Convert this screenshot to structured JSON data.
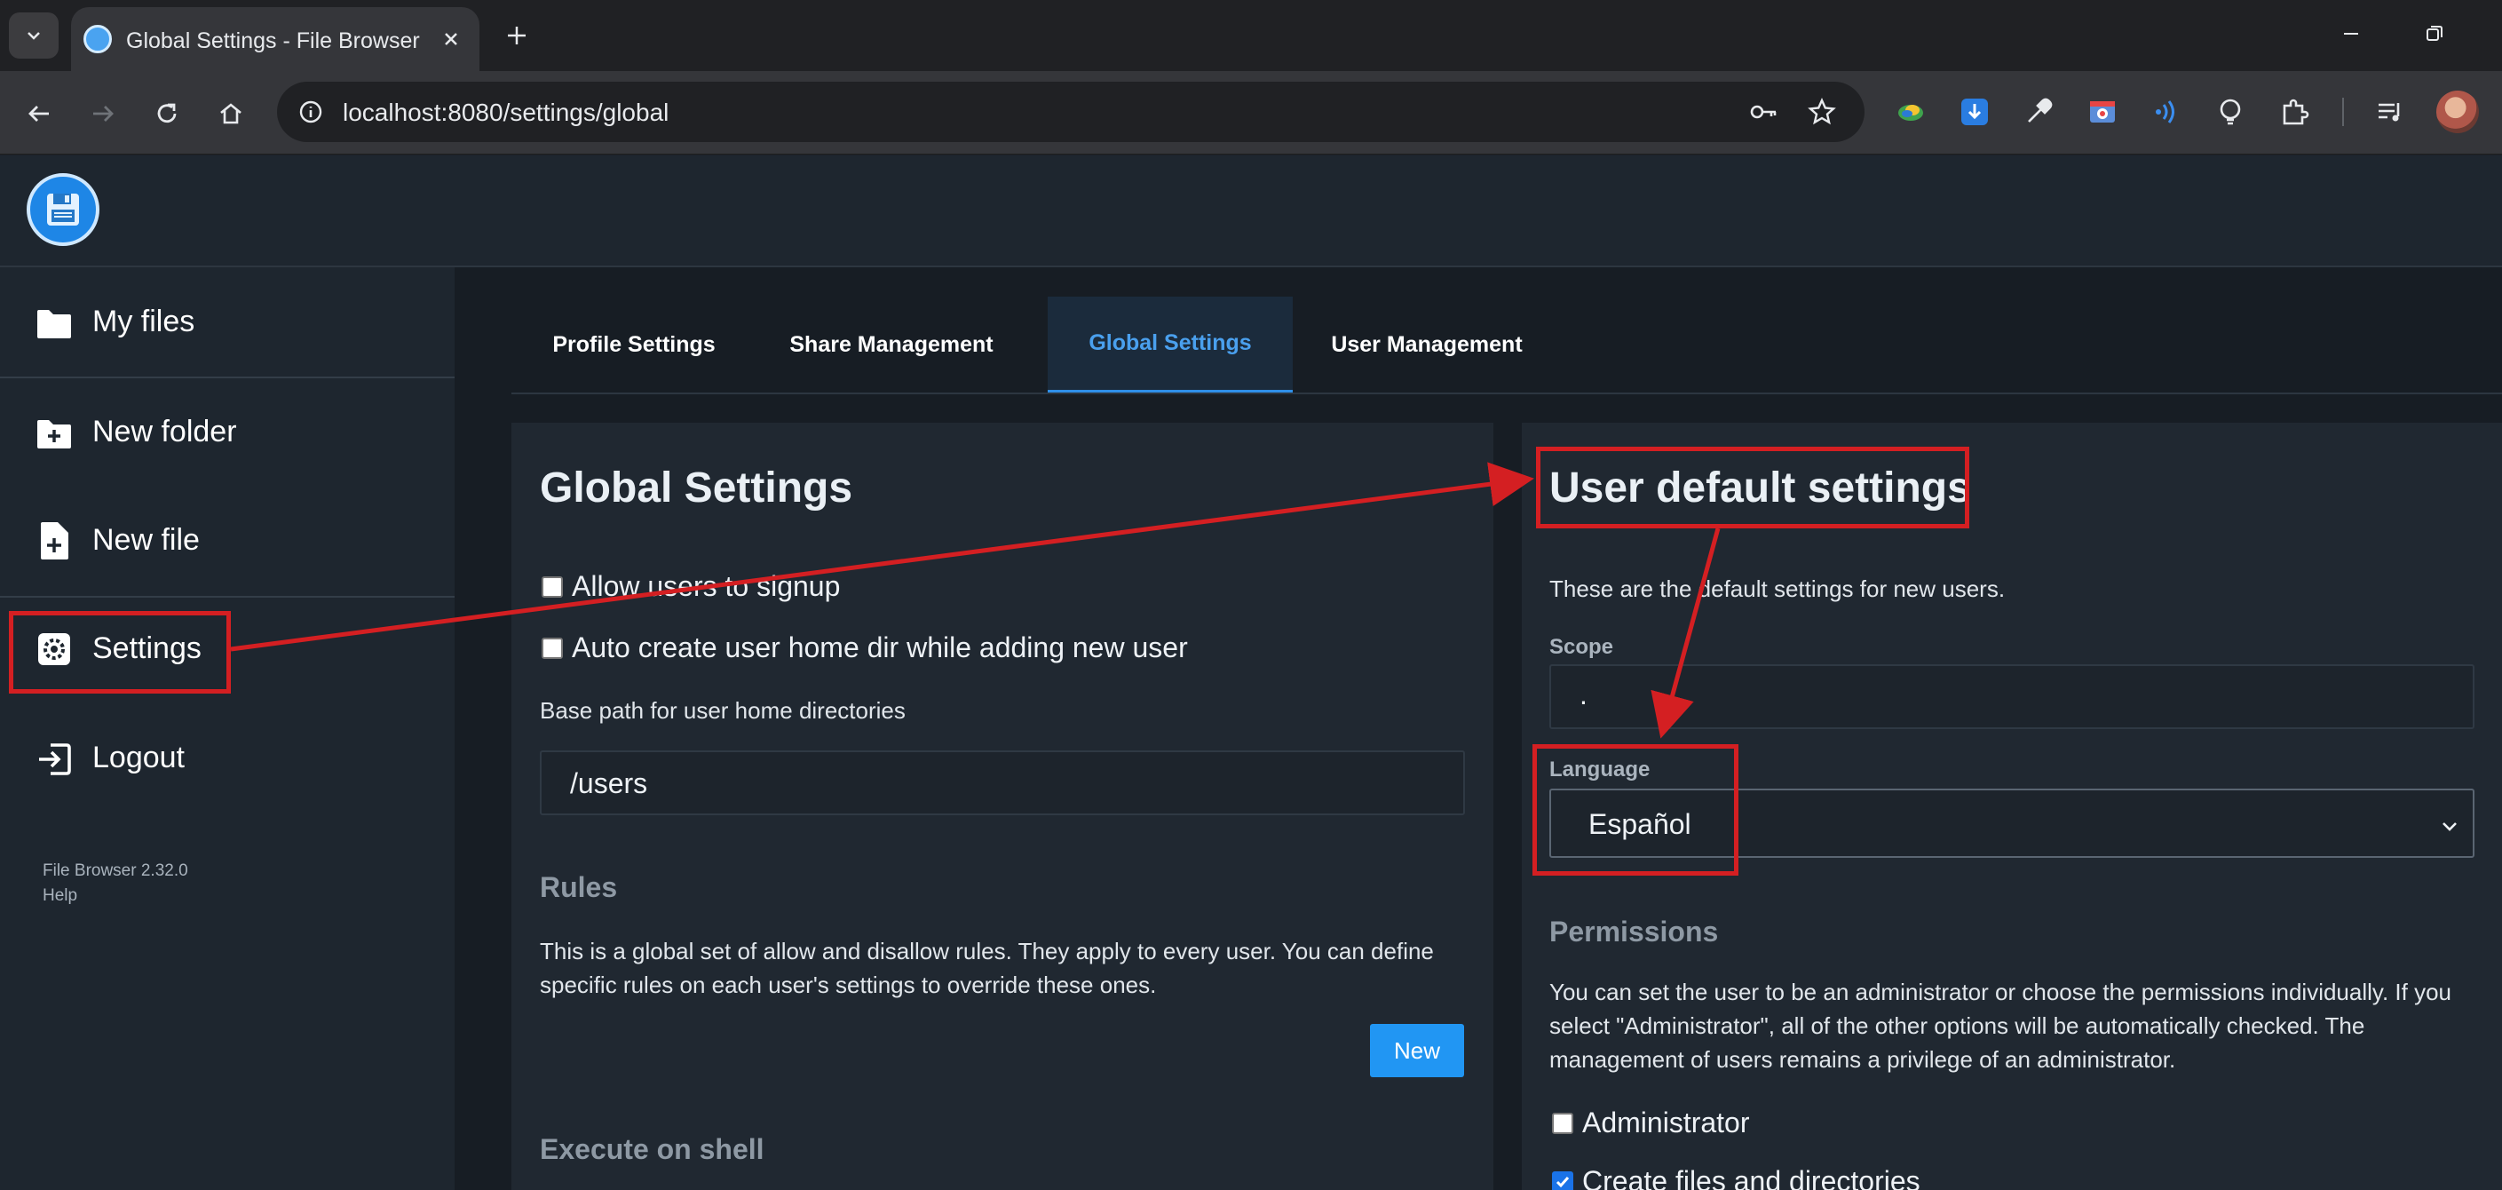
{
  "browser": {
    "tab_title": "Global Settings - File Browser",
    "url": "localhost:8080/settings/global"
  },
  "sidebar": {
    "items": [
      {
        "label": "My files",
        "icon": "folder-icon"
      },
      {
        "label": "New folder",
        "icon": "folder-plus-icon"
      },
      {
        "label": "New file",
        "icon": "file-plus-icon"
      },
      {
        "label": "Settings",
        "icon": "gear-icon"
      },
      {
        "label": "Logout",
        "icon": "logout-icon"
      }
    ],
    "version": "File Browser 2.32.0",
    "help": "Help"
  },
  "settings_tabs": [
    {
      "label": "Profile Settings",
      "active": false
    },
    {
      "label": "Share Management",
      "active": false
    },
    {
      "label": "Global Settings",
      "active": true
    },
    {
      "label": "User Management",
      "active": false
    }
  ],
  "global_settings": {
    "title": "Global Settings",
    "allow_signup": {
      "label": "Allow users to signup",
      "checked": false
    },
    "auto_create_home": {
      "label": "Auto create user home dir while adding new user",
      "checked": false
    },
    "base_path_label": "Base path for user home directories",
    "base_path_value": "/users",
    "rules_title": "Rules",
    "rules_line1": "This is a global set of allow and disallow rules. They apply to every user. You can define",
    "rules_line2": "specific rules on each user's settings to override these ones.",
    "new_button": "New",
    "execute_title": "Execute on shell"
  },
  "user_defaults": {
    "title": "User default settings",
    "description": "These are the default settings for new users.",
    "scope_label": "Scope",
    "scope_value": ".",
    "language_label": "Language",
    "language_value": "Español",
    "permissions_title": "Permissions",
    "permissions_line1": "You can set the user to be an administrator or choose the permissions individually. If you",
    "permissions_line2": "select \"Administrator\", all of the other options will be automatically checked. The",
    "permissions_line3": "management of users remains a privilege of an administrator.",
    "administrator": {
      "label": "Administrator",
      "checked": false
    },
    "create_files": {
      "label": "Create files and directories",
      "checked": true
    }
  },
  "colors": {
    "accent": "#2196f3",
    "annotation": "#d41f22",
    "background": "#171d24",
    "card": "#202831"
  }
}
